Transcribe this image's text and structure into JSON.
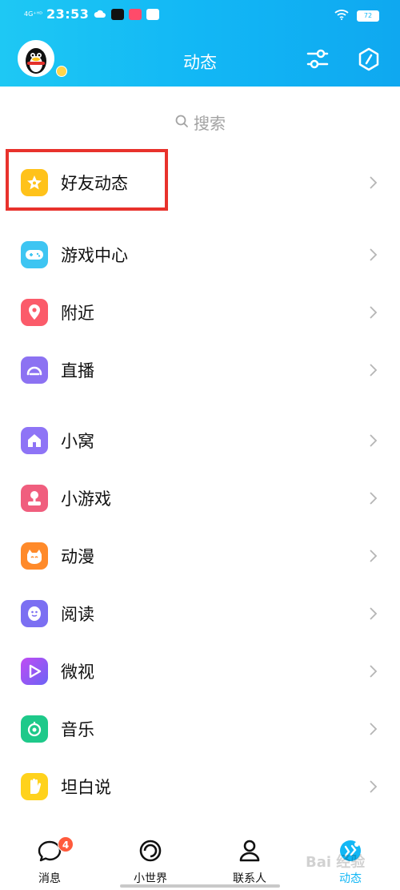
{
  "status_bar": {
    "network": "4G⁺ᴴᴰ",
    "time": "23:53",
    "battery": "72"
  },
  "header": {
    "title": "动态"
  },
  "search": {
    "label": "搜索"
  },
  "menu_items": [
    {
      "label": "好友动态",
      "icon": "star-icon",
      "color": "#ffc21a"
    },
    {
      "label": "游戏中心",
      "icon": "gamepad-icon",
      "color": "#3ec5f2"
    },
    {
      "label": "附近",
      "icon": "location-pin-icon",
      "color": "#fb5b6a"
    },
    {
      "label": "直播",
      "icon": "live-icon",
      "color": "#8c72f2"
    },
    {
      "label": "小窝",
      "icon": "home-icon",
      "color": "#8e74f6"
    },
    {
      "label": "小游戏",
      "icon": "joystick-icon",
      "color": "#f05e7e"
    },
    {
      "label": "动漫",
      "icon": "anime-face-icon",
      "color": "#ff8a2a"
    },
    {
      "label": "阅读",
      "icon": "reading-penguin-icon",
      "color": "#7b6ff2"
    },
    {
      "label": "微视",
      "icon": "play-icon",
      "color": "#8f5cf6"
    },
    {
      "label": "音乐",
      "icon": "music-icon",
      "color": "#1ec98a"
    },
    {
      "label": "坦白说",
      "icon": "hand-icon",
      "color": "#ffd21c"
    }
  ],
  "tabbar": {
    "tabs": [
      {
        "label": "消息",
        "icon": "chat-bubble-icon",
        "badge": "4"
      },
      {
        "label": "小世界",
        "icon": "small-world-icon"
      },
      {
        "label": "联系人",
        "icon": "contacts-icon"
      },
      {
        "label": "动态",
        "icon": "explore-icon",
        "active": true
      }
    ]
  },
  "watermark": {
    "text": "Bai 经验"
  },
  "colors": {
    "header": "#12b7f5",
    "highlight": "#e8322c"
  }
}
